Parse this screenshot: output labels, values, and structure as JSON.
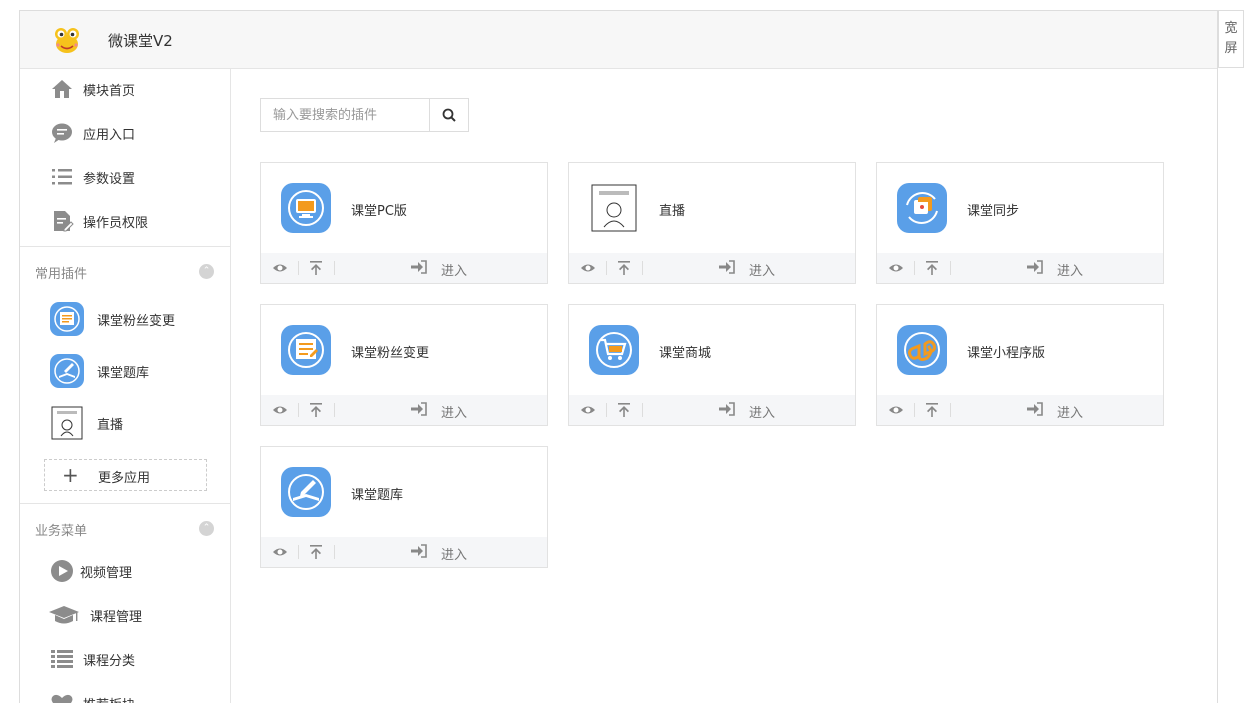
{
  "app": {
    "title": "微课堂V2"
  },
  "wide_button": {
    "chars": [
      "宽",
      "屏"
    ]
  },
  "sidebar": {
    "top_items": [
      {
        "label": "模块首页",
        "icon": "home-icon"
      },
      {
        "label": "应用入口",
        "icon": "chat-bubble-icon"
      },
      {
        "label": "参数设置",
        "icon": "list-settings-icon"
      },
      {
        "label": "操作员权限",
        "icon": "document-edit-icon"
      }
    ],
    "common_section": {
      "label": "常用插件",
      "plugins": [
        {
          "label": "课堂粉丝变更",
          "icon": "fans-change-icon"
        },
        {
          "label": "课堂题库",
          "icon": "question-bank-icon"
        },
        {
          "label": "直播",
          "icon": "live-sketch-icon"
        }
      ],
      "more_label": "更多应用"
    },
    "business_section": {
      "label": "业务菜单",
      "items": [
        {
          "label": "视频管理",
          "icon": "play-circle-icon"
        },
        {
          "label": "课程管理",
          "icon": "graduation-cap-icon"
        },
        {
          "label": "课程分类",
          "icon": "list-icon"
        },
        {
          "label": "推荐板块",
          "icon": "heart-icon"
        }
      ]
    }
  },
  "search": {
    "placeholder": "输入要搜索的插件"
  },
  "cards": [
    {
      "name": "课堂PC版",
      "icon": "monitor-icon",
      "enter": "进入"
    },
    {
      "name": "直播",
      "icon": "live-sketch-icon",
      "enter": "进入"
    },
    {
      "name": "课堂同步",
      "icon": "sync-icon",
      "enter": "进入"
    },
    {
      "name": "课堂粉丝变更",
      "icon": "fans-change-icon",
      "enter": "进入"
    },
    {
      "name": "课堂商城",
      "icon": "shopping-cart-icon",
      "enter": "进入"
    },
    {
      "name": "课堂小程序版",
      "icon": "mini-program-icon",
      "enter": "进入"
    },
    {
      "name": "课堂题库",
      "icon": "question-bank-icon",
      "enter": "进入"
    }
  ],
  "colors": {
    "icon_blue": "#5a9fe8",
    "icon_orange": "#f39a1e",
    "sidebar_icon_gray": "#8c8c8c"
  }
}
